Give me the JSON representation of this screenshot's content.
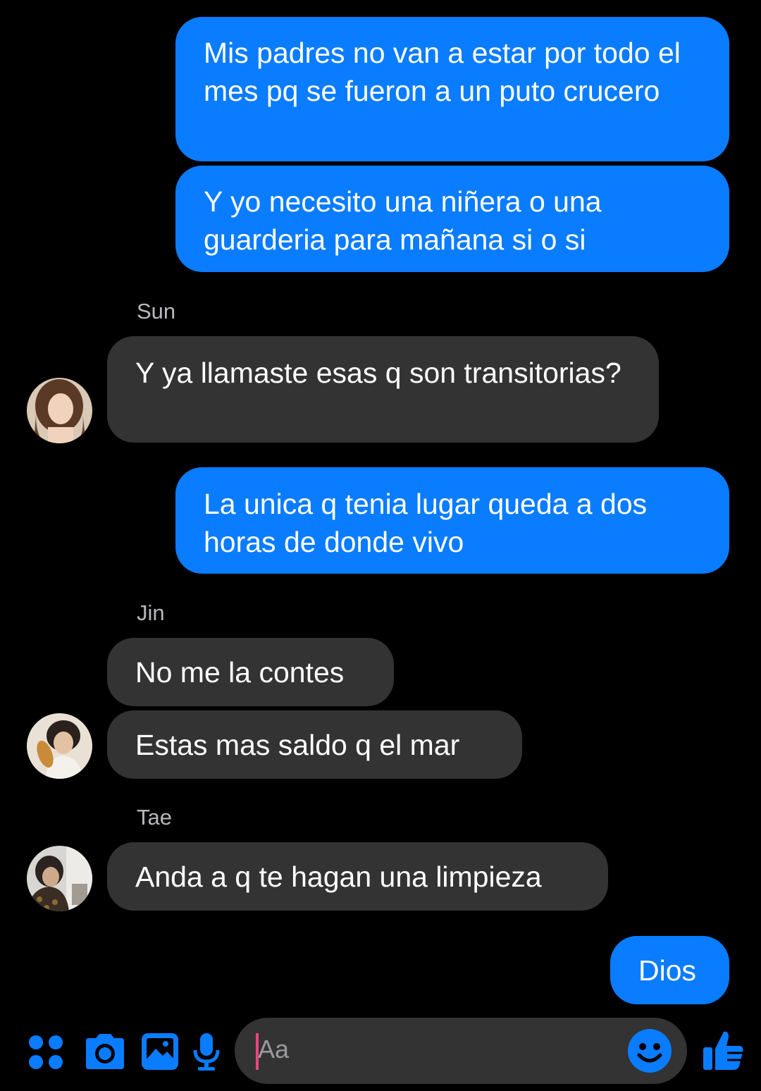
{
  "colors": {
    "background": "#000000",
    "outgoing_bubble": "#0a7cff",
    "incoming_bubble": "#333334",
    "accent": "#0a7cff",
    "sender_name": "#b8b8bc"
  },
  "messages": [
    {
      "direction": "outgoing",
      "text": "Mis padres no van a estar por todo el mes pq se fueron a un puto crucero"
    },
    {
      "direction": "outgoing",
      "text": "Y yo necesito una niñera o una guarderia para mañana si o si"
    },
    {
      "direction": "incoming",
      "sender": "Sun",
      "text": "Y ya llamaste esas q son transitorias?"
    },
    {
      "direction": "outgoing",
      "text": "La unica q tenia lugar queda a dos horas de donde vivo"
    },
    {
      "direction": "incoming",
      "sender": "Jin",
      "text": "No me la contes"
    },
    {
      "direction": "incoming",
      "sender": "Jin",
      "text": "Estas mas saldo q el mar"
    },
    {
      "direction": "incoming",
      "sender": "Tae",
      "text": "Anda a q te hagan una limpieza"
    },
    {
      "direction": "outgoing",
      "text": "Dios"
    }
  ],
  "composer": {
    "placeholder": "Aa",
    "icons": [
      "menu-dots-icon",
      "camera-icon",
      "gallery-icon",
      "microphone-icon",
      "emoji-icon",
      "thumbs-up-icon"
    ]
  }
}
